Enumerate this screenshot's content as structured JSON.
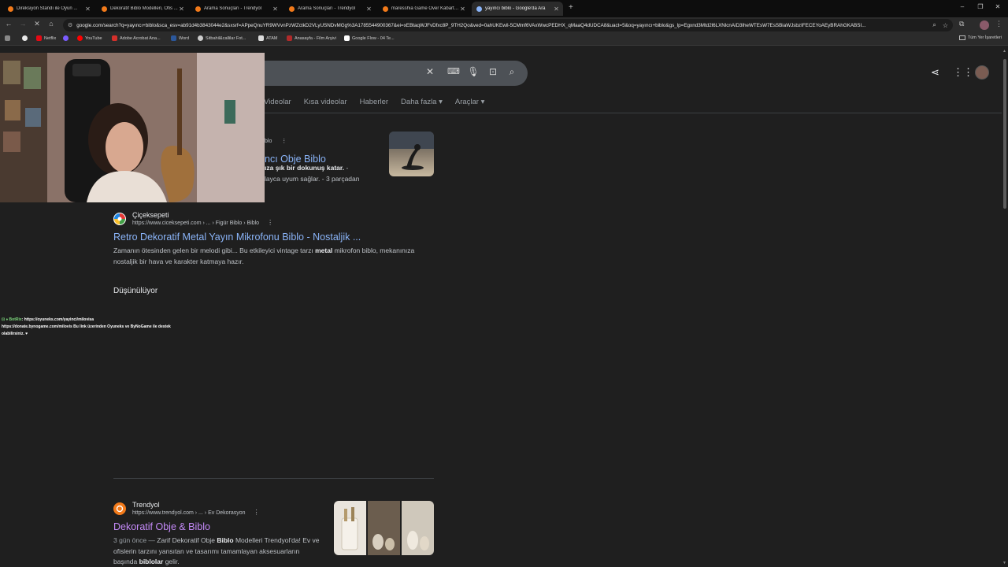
{
  "tabs": [
    {
      "title": "Direksiyon Standı ile Oyun ...",
      "active": false,
      "fav_color": "#f27a1a"
    },
    {
      "title": "Dekoratif Biblo Modelleri, Ofis ...",
      "active": false,
      "fav_color": "#f27a1a"
    },
    {
      "title": "Arama Sonuçları - Trendyol",
      "active": false,
      "fav_color": "#f27a1a"
    },
    {
      "title": "Arama Sonuçları - Trendyol",
      "active": false,
      "fav_color": "#f27a1a"
    },
    {
      "title": "maresshia Game Over Kabartm...",
      "active": false,
      "fav_color": "#f27a1a"
    },
    {
      "title": "yayıncı biblo - Google'da Ara",
      "active": true,
      "fav_color": "#8ab4f8"
    }
  ],
  "toolbar": {
    "url": "google.com/search?q=yayıncı+biblo&sca_esv=ab91d4b3843044e2&sxsrf=APpeQnuYR9WVvnPzWZctkD2VLyUSNDvMGg%3A1785544900367&ei=xEBtaqWJFvDfxc8P_9TH2Qo&ved=0ahUKEwil-5CMmf6VAxWwcPEDHX_qMaaQ4dUDCA8&uact=5&oq=yayıncı+biblo&gs_lp=Egxnd3Mtd2l6LXNlcnAiD3lheWTEsW7EsSBiaWJsbzIFECEYoAEyBRAhGKABSI..."
  },
  "bookmarks": [
    {
      "label": "Netflix",
      "color": "#e50914"
    },
    {
      "label": "YouTube",
      "color": "#ff0000"
    },
    {
      "label": "Adobe Acrobat Ana...",
      "color": "#d4302b"
    },
    {
      "label": "Word",
      "color": "#2b579a"
    },
    {
      "label": "Sitbahil&callilar Fot...",
      "color": "#cccccc"
    },
    {
      "label": "ATAM",
      "color": "#dddddd"
    },
    {
      "label": "Anasayfa - Film Arşivi",
      "color": "#b02a2a"
    },
    {
      "label": "Google Flow - 04 Te...",
      "color": "#ffffff"
    }
  ],
  "bookmarks_all": "Tüm Yer İşaretleri",
  "filters": [
    "Videolar",
    "Kısa videolar",
    "Haberler",
    "Daha fazla ▾",
    "Araçlar ▾"
  ],
  "result1": {
    "dots_prefix": "blo",
    "title": "ncı Obje Biblo",
    "snip_line1_bold": "ıza şık bir dokunuş katar.",
    "snip_line1_rest": " -",
    "snip_line2": "layca uyum sağlar. - 3 parçadan"
  },
  "result2": {
    "site": "Çiçeksepeti",
    "cite": "https://www.ciceksepeti.com › ... › Figür Biblo › Biblo",
    "title": "Retro Dekoratif Metal Yayın Mikrofonu Biblo - Nostaljik ...",
    "snip_a": "Zamanın ötesinden gelen bir melodi gibi... Bu etkileyici vintage tarzı ",
    "snip_bold": "metal",
    "snip_b": " mikrofon biblo, mekanınıza nostaljik bir hava ve karakter katmaya hazır."
  },
  "thinking": "Düşünülüyor",
  "result3": {
    "site": "Trendyol",
    "cite": "https://www.trendyol.com › ... › Ev Dekorasyon",
    "title": "Dekoratif Obje & Biblo",
    "date": "3 gün önce — ",
    "snip_a": "Zarif Dekoratif Obje ",
    "snip_bold1": "Biblo",
    "snip_b": " Modelleri Trendyol'da! Ev ve ofislerin tarzını yansıtan ve tasarımı tamamlayan aksesuarların başında ",
    "snip_bold2": "biblolar",
    "snip_c": " gelir."
  },
  "botrix": {
    "name": "BotRix",
    "line1": ": https://oyuneks.com/yayinci/milovisa",
    "line2": "https://donate.bynogame.com/milovis Bu link üzerinden Oyuneks ve ByNoGame ile destek olabilirsiniz. ♥"
  },
  "colors": {
    "accent_link": "#8ab4f8",
    "visited_link": "#c58af9",
    "background": "#1f1f1f"
  }
}
